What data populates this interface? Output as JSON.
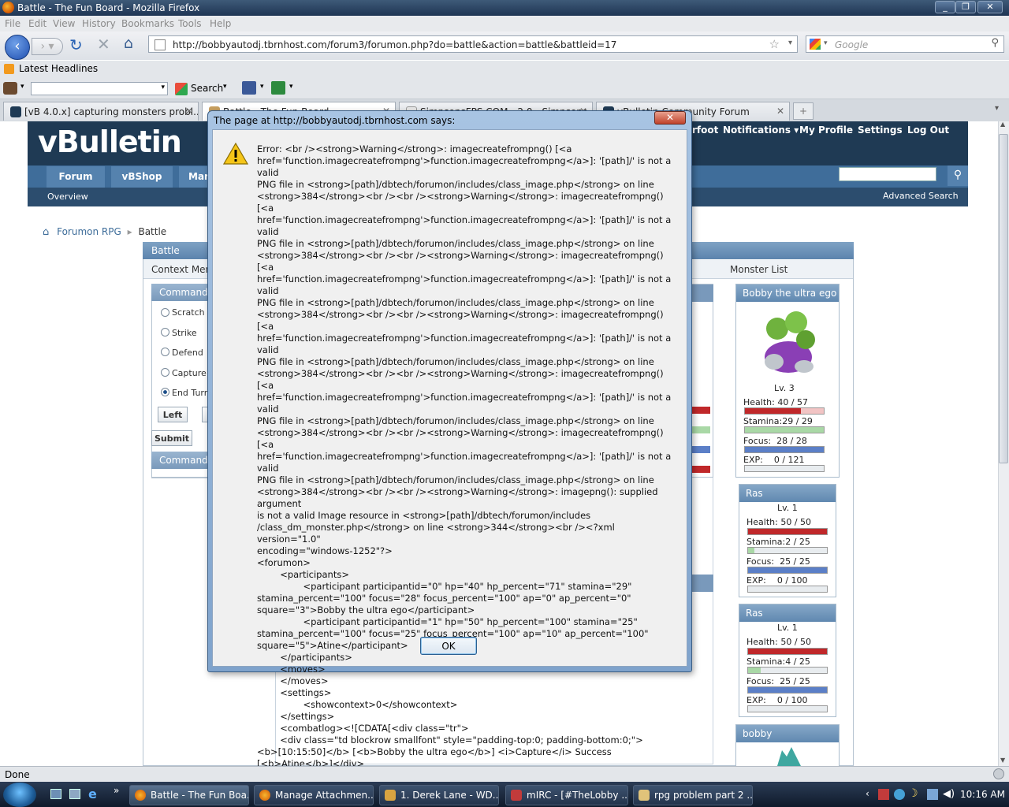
{
  "window": {
    "title": "Battle - The Fun Board - Mozilla Firefox",
    "controls": [
      "_",
      "❐",
      "✕"
    ]
  },
  "menu": [
    "File",
    "Edit",
    "View",
    "History",
    "Bookmarks",
    "Tools",
    "Help"
  ],
  "nav": {
    "url": "http://bobbyautodj.tbrnhost.com/forum3/forumon.php?do=battle&action=battle&battleid=17",
    "search_placeholder": "Google"
  },
  "bookmarks": {
    "latest_headlines": "Latest Headlines",
    "search_label": "Search"
  },
  "tabs": [
    {
      "label": "[vB 4.0.x] capturing monsters probl...",
      "active": false
    },
    {
      "label": "Battle - The Fun Board",
      "active": true
    },
    {
      "label": "SimpsonsFPS.COM - 2.0 - Simpsons...",
      "active": false
    },
    {
      "label": "vBulletin Community Forum",
      "active": false
    }
  ],
  "vb": {
    "logo": "vBulletin",
    "toplinks": [
      "Notifications ▾",
      "My Profile",
      "Settings",
      "Log Out"
    ],
    "toplink_partial": "rfoot",
    "navtabs": [
      "Forum",
      "vBShop",
      "Mar"
    ],
    "subnav": "Overview",
    "advanced_search": "Advanced Search",
    "breadcrumb_root": "Forumon RPG",
    "breadcrumb_current": "Battle"
  },
  "battle": {
    "title": "Battle",
    "context_menu": "Context Men",
    "commands_title": "Commands",
    "commands": [
      "Scratch",
      "Strike",
      "Defend",
      "Capture",
      "End Turn"
    ],
    "selected_command": "End Turn",
    "left_button": "Left",
    "submit_button": "Submit",
    "command_box": "Command",
    "monster_list_title": "Monster List"
  },
  "monsters": [
    {
      "name": "Bobby the ultra ego",
      "level": "Lv. 3",
      "health": "40 / 57",
      "health_pct": 0.71,
      "stamina": "29 / 29",
      "stamina_pct": 1.0,
      "focus": "28 / 28",
      "focus_pct": 1.0,
      "exp": "0 / 121",
      "exp_pct": 0.0
    },
    {
      "name": "Ras",
      "level": "Lv. 1",
      "health": "50 / 50",
      "health_pct": 1.0,
      "stamina": "2 / 25",
      "stamina_pct": 0.08,
      "focus": "25 / 25",
      "focus_pct": 1.0,
      "exp": "0 / 100",
      "exp_pct": 0.0
    },
    {
      "name": "Ras",
      "level": "Lv. 1",
      "health": "50 / 50",
      "health_pct": 1.0,
      "stamina": "4 / 25",
      "stamina_pct": 0.16,
      "focus": "25 / 25",
      "focus_pct": 1.0,
      "exp": "0 / 100",
      "exp_pct": 0.0
    },
    {
      "name": "bobby"
    }
  ],
  "stat_labels": {
    "health": "Health:",
    "stamina": "Stamina:",
    "focus": "Focus:",
    "exp": "EXP:"
  },
  "dialog": {
    "title": "The page at http://bobbyautodj.tbrnhost.com says:",
    "close": "✕",
    "message": "Error: <br /><strong>Warning</strong>: imagecreatefrompng() [<a\nhref='function.imagecreatefrompng'>function.imagecreatefrompng</a>]: '[path]/' is not a valid\nPNG file in <strong>[path]/dbtech/forumon/includes/class_image.php</strong> on line\n<strong>384</strong><br /><br /><strong>Warning</strong>: imagecreatefrompng() [<a\nhref='function.imagecreatefrompng'>function.imagecreatefrompng</a>]: '[path]/' is not a valid\nPNG file in <strong>[path]/dbtech/forumon/includes/class_image.php</strong> on line\n<strong>384</strong><br /><br /><strong>Warning</strong>: imagecreatefrompng() [<a\nhref='function.imagecreatefrompng'>function.imagecreatefrompng</a>]: '[path]/' is not a valid\nPNG file in <strong>[path]/dbtech/forumon/includes/class_image.php</strong> on line\n<strong>384</strong><br /><br /><strong>Warning</strong>: imagecreatefrompng() [<a\nhref='function.imagecreatefrompng'>function.imagecreatefrompng</a>]: '[path]/' is not a valid\nPNG file in <strong>[path]/dbtech/forumon/includes/class_image.php</strong> on line\n<strong>384</strong><br /><br /><strong>Warning</strong>: imagecreatefrompng() [<a\nhref='function.imagecreatefrompng'>function.imagecreatefrompng</a>]: '[path]/' is not a valid\nPNG file in <strong>[path]/dbtech/forumon/includes/class_image.php</strong> on line\n<strong>384</strong><br /><br /><strong>Warning</strong>: imagecreatefrompng() [<a\nhref='function.imagecreatefrompng'>function.imagecreatefrompng</a>]: '[path]/' is not a valid\nPNG file in <strong>[path]/dbtech/forumon/includes/class_image.php</strong> on line\n<strong>384</strong><br /><br /><strong>Warning</strong>: imagepng(): supplied argument\nis not a valid Image resource in <strong>[path]/dbtech/forumon/includes\n/class_dm_monster.php</strong> on line <strong>344</strong><br /><?xml version=\"1.0\"\nencoding=\"windows-1252\"?>\n<forumon>\n        <participants>\n                <participant participantid=\"0\" hp=\"40\" hp_percent=\"71\" stamina=\"29\"\nstamina_percent=\"100\" focus=\"28\" focus_percent=\"100\" ap=\"0\" ap_percent=\"0\"\nsquare=\"3\">Bobby the ultra ego</participant>\n                <participant participantid=\"1\" hp=\"50\" hp_percent=\"100\" stamina=\"25\"\nstamina_percent=\"100\" focus=\"25\" focus_percent=\"100\" ap=\"10\" ap_percent=\"100\"\nsquare=\"5\">Atine</participant>\n        </participants>\n        <moves>\n        </moves>\n        <settings>\n                <showcontext>0</showcontext>\n        </settings>\n        <combatlog><![CDATA[<div class=\"tr\">\n        <div class=\"td blockrow smallfont\" style=\"padding-top:0; padding-bottom:0;\">\n<b>[10:15:50]</b> [<b>Bobby the ultra ego</b>] <i>Capture</i> Success [<b>Atine</b>]</div>\n</div> ]]></combatlog>\n</forumon>",
    "ok": "OK"
  },
  "status": "Done",
  "taskbar": {
    "items": [
      {
        "label": "Battle - The Fun Boa...",
        "active": true
      },
      {
        "label": "Manage Attachmen...",
        "active": false
      },
      {
        "label": "1. Derek Lane - WD...",
        "active": false
      },
      {
        "label": "mIRC - [#TheLobby ...",
        "active": false
      },
      {
        "label": "rpg problem part 2 ...",
        "active": false
      }
    ],
    "clock": "10:16 AM"
  },
  "colors": {
    "health": "#c0282a",
    "health_bg": "#f2c4c4",
    "stamina": "#a9d8a6",
    "focus": "#5b7fc7",
    "vb_header": "#1f3a54"
  }
}
